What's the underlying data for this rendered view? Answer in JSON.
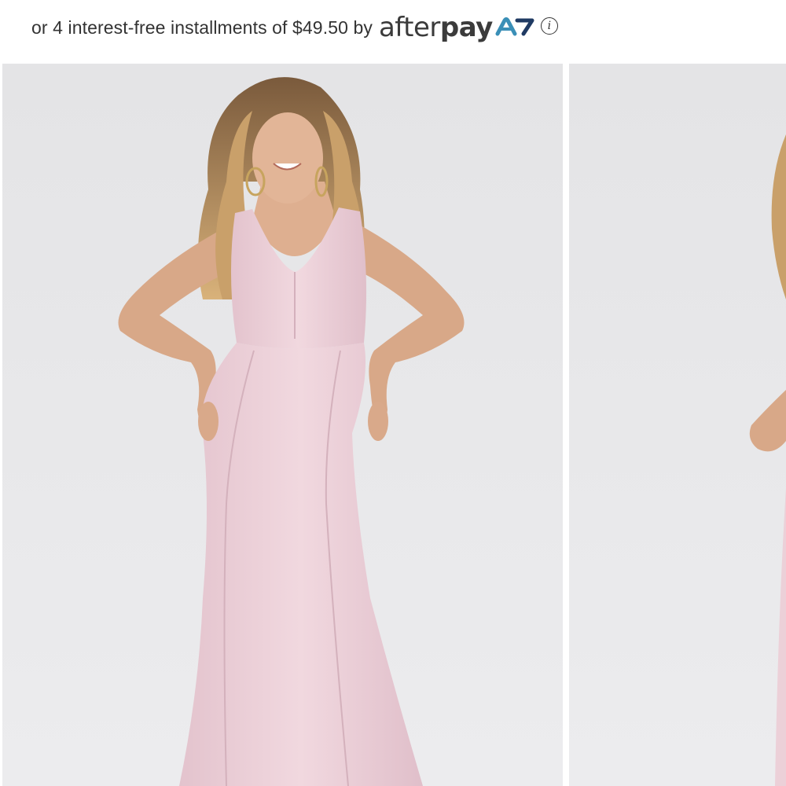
{
  "afterpay": {
    "message": "or 4 interest-free installments of $49.50 by",
    "logo_text_light": "after",
    "logo_text_bold": "pay",
    "logo_colors": {
      "wordmark": "#3b3b3b",
      "mark_blue": "#3a8fb7",
      "mark_navy": "#1f3a63"
    },
    "info_icon": "info-circle-icon",
    "info_glyph": "i"
  },
  "gallery": {
    "images": [
      {
        "name": "product-image-front",
        "subject": "model wearing long blush-pink v-neck sleeveless gown, hands on hips",
        "dress_color": "#ecd0d8",
        "background_color": "#e6e6e8"
      },
      {
        "name": "product-image-side",
        "subject": "partially visible second view of the gown",
        "dress_color": "#ecd0d8",
        "background_color": "#e6e6e8"
      }
    ]
  }
}
